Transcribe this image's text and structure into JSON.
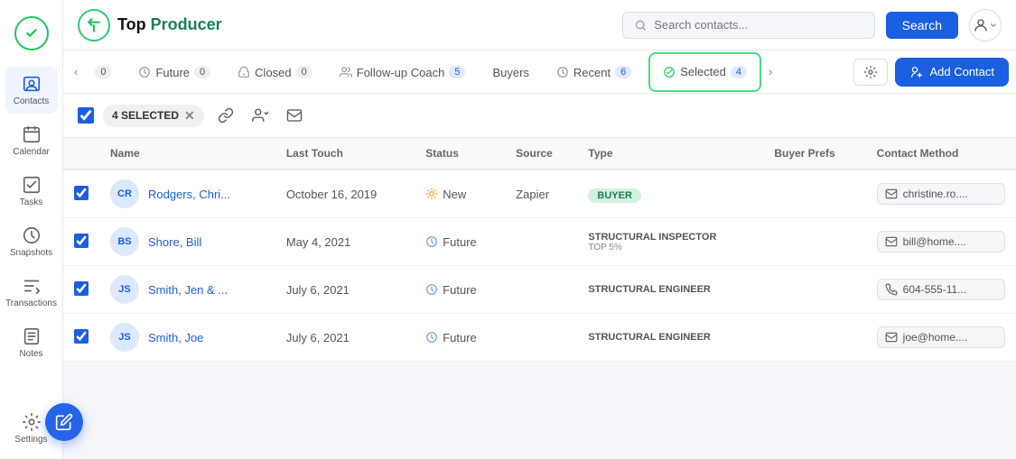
{
  "logo": {
    "text": "Top Producer"
  },
  "header": {
    "search_placeholder": "Search contacts...",
    "search_button": "Search",
    "add_contact_button": "Add Contact"
  },
  "tabs": [
    {
      "id": "unnamed",
      "label": "",
      "badge": "0",
      "icon": "dot"
    },
    {
      "id": "future",
      "label": "Future",
      "badge": "0",
      "icon": "future"
    },
    {
      "id": "closed",
      "label": "Closed",
      "badge": "0",
      "icon": "closed"
    },
    {
      "id": "followup",
      "label": "Follow-up Coach",
      "badge": "5",
      "icon": "followup"
    },
    {
      "id": "buyers",
      "label": "Buyers",
      "badge": "",
      "icon": "buyers"
    },
    {
      "id": "recent",
      "label": "Recent",
      "badge": "6",
      "icon": "recent"
    },
    {
      "id": "selected",
      "label": "Selected",
      "badge": "4",
      "icon": "selected",
      "active": true
    }
  ],
  "toolbar": {
    "selected_count": "4 SELECTED"
  },
  "table": {
    "columns": [
      "Name",
      "Last Touch",
      "Status",
      "Source",
      "Type",
      "Buyer Prefs",
      "Contact Method"
    ],
    "rows": [
      {
        "checked": true,
        "initials": "CR",
        "name": "Rodgers, Chri...",
        "last_touch": "October 16, 2019",
        "status": "New",
        "status_icon": "sun",
        "source": "Zapier",
        "type": "BUYER",
        "type_sub": "",
        "buyer_prefs": "",
        "contact_method_icon": "email",
        "contact_method": "christine.ro...."
      },
      {
        "checked": true,
        "initials": "BS",
        "name": "Shore, Bill",
        "last_touch": "May 4, 2021",
        "status": "Future",
        "status_icon": "future",
        "source": "",
        "type": "STRUCTURAL INSPECTOR",
        "type_sub": "TOP 5%",
        "buyer_prefs": "",
        "contact_method_icon": "email",
        "contact_method": "bill@home...."
      },
      {
        "checked": true,
        "initials": "JS",
        "name": "Smith, Jen & ...",
        "last_touch": "July 6, 2021",
        "status": "Future",
        "status_icon": "future",
        "source": "",
        "type": "STRUCTURAL ENGINEER",
        "type_sub": "",
        "buyer_prefs": "",
        "contact_method_icon": "phone",
        "contact_method": "604-555-11..."
      },
      {
        "checked": true,
        "initials": "JS",
        "name": "Smith, Joe",
        "last_touch": "July 6, 2021",
        "status": "Future",
        "status_icon": "future",
        "source": "",
        "type": "STRUCTURAL ENGINEER",
        "type_sub": "",
        "buyer_prefs": "",
        "contact_method_icon": "email",
        "contact_method": "joe@home...."
      }
    ]
  },
  "sidebar": {
    "items": [
      {
        "id": "contacts",
        "label": "Contacts",
        "icon": "contacts"
      },
      {
        "id": "calendar",
        "label": "Calendar",
        "icon": "calendar"
      },
      {
        "id": "tasks",
        "label": "Tasks",
        "icon": "tasks"
      },
      {
        "id": "snapshots",
        "label": "Snapshots",
        "icon": "snapshots"
      },
      {
        "id": "transactions",
        "label": "Transactions",
        "icon": "transactions"
      },
      {
        "id": "notes",
        "label": "Notes",
        "icon": "notes"
      },
      {
        "id": "settings",
        "label": "Settings",
        "icon": "settings"
      }
    ]
  }
}
